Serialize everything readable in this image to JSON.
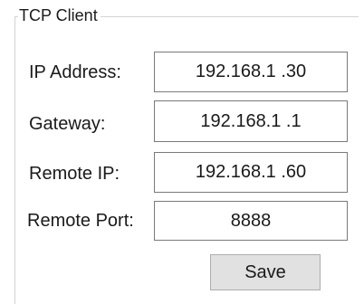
{
  "group": {
    "title": "TCP Client"
  },
  "fields": {
    "ip_address": {
      "label": "IP Address:",
      "value": "192.168.1 .30"
    },
    "gateway": {
      "label": "Gateway:",
      "value": "192.168.1 .1"
    },
    "remote_ip": {
      "label": "Remote IP:",
      "value": "192.168.1 .60"
    },
    "remote_port": {
      "label": "Remote Port:",
      "value": "8888"
    }
  },
  "buttons": {
    "save_label": "Save"
  }
}
